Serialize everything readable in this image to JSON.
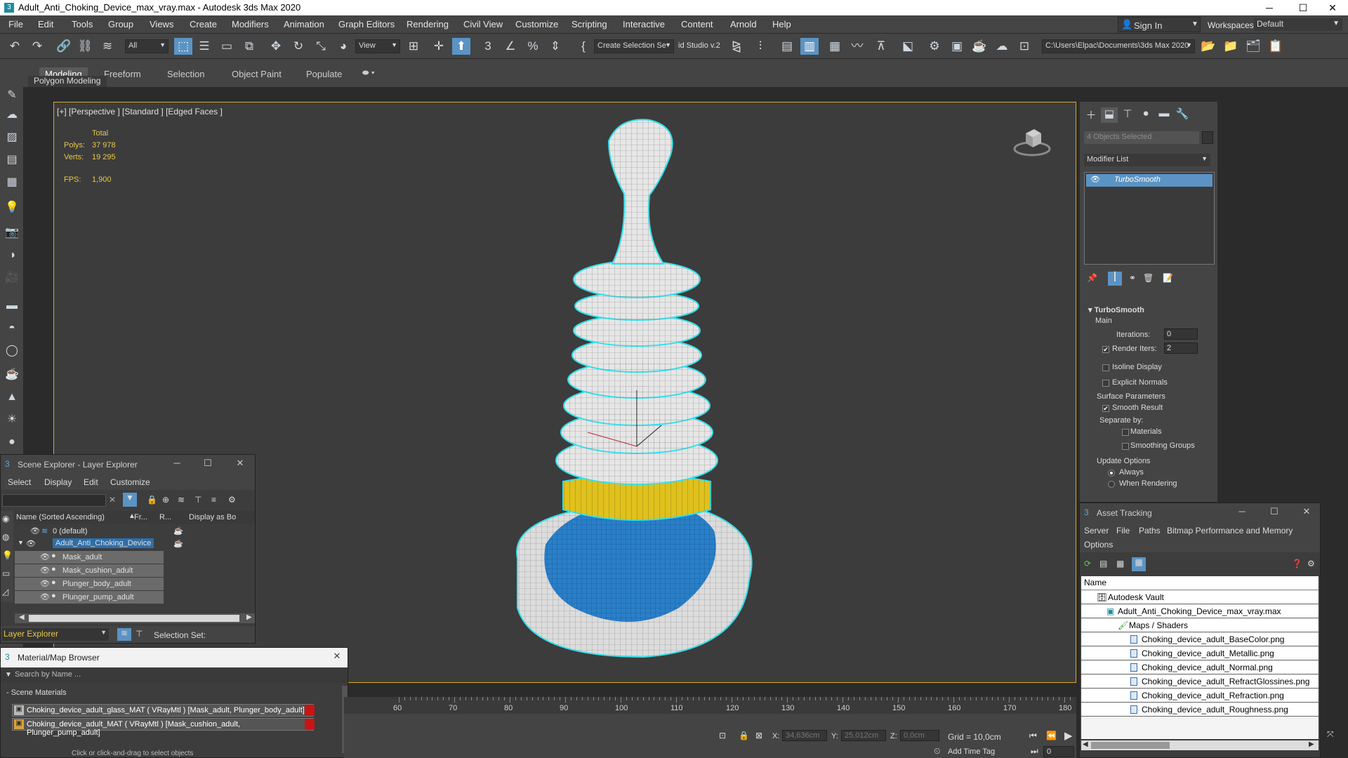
{
  "window": {
    "title": "Adult_Anti_Choking_Device_max_vray.max - Autodesk 3ds Max 2020",
    "app_icon": "3",
    "minimize_icon": "─",
    "maximize_icon": "☐",
    "close_icon": "✕"
  },
  "menu": [
    "File",
    "Edit",
    "Tools",
    "Group",
    "Views",
    "Create",
    "Modifiers",
    "Animation",
    "Graph Editors",
    "Rendering",
    "Civil View",
    "Customize",
    "Scripting",
    "Interactive",
    "Content",
    "Arnold",
    "Help"
  ],
  "account": {
    "sign_in": "Sign In",
    "workspaces_label": "Workspaces:",
    "workspace": "Default"
  },
  "toolbar": {
    "selection_filter": "All",
    "ref_coord": "View",
    "named_selection": "Create Selection Se",
    "studio": "id Studio v.2",
    "project_path": "C:\\Users\\Elpac\\Documents\\3ds Max 2020"
  },
  "ribbon": {
    "tabs": [
      "Modeling",
      "Freeform",
      "Selection",
      "Object Paint",
      "Populate"
    ],
    "active": "Modeling",
    "sub_label": "Polygon Modeling"
  },
  "viewport": {
    "label": "[+] [Perspective ] [Standard ] [Edged Faces ]",
    "stats": {
      "header": "Total",
      "polys_label": "Polys:",
      "polys": "37 978",
      "verts_label": "Verts:",
      "verts": "19 295",
      "fps_label": "FPS:",
      "fps": "1,900"
    }
  },
  "command_panel": {
    "selection": "4 Objects Selected",
    "modifier_list": "Modifier List",
    "stack_item": "TurboSmooth",
    "rollout_title": "TurboSmooth",
    "main_label": "Main",
    "iterations_label": "Iterations:",
    "iterations": "0",
    "render_iters_label": "Render Iters:",
    "render_iters": "2",
    "isoline": "Isoline Display",
    "explicit_normals": "Explicit Normals",
    "surface_params": "Surface Parameters",
    "smooth_result": "Smooth Result",
    "separate_by": "Separate by:",
    "materials": "Materials",
    "smoothing_groups": "Smoothing Groups",
    "update_options": "Update Options",
    "always": "Always",
    "when_rendering": "When Rendering"
  },
  "scene_explorer": {
    "title": "Scene Explorer - Layer Explorer",
    "menu": [
      "Select",
      "Display",
      "Edit",
      "Customize"
    ],
    "columns": [
      "Name (Sorted Ascending)",
      "Fr...",
      "R...",
      "Display as Bo"
    ],
    "rows": [
      {
        "name": "0 (default)",
        "level": 1
      },
      {
        "name": "Adult_Anti_Choking_Device",
        "level": 1
      },
      {
        "name": "Mask_adult",
        "level": 2
      },
      {
        "name": "Mask_cushion_adult",
        "level": 2
      },
      {
        "name": "Plunger_body_adult",
        "level": 2
      },
      {
        "name": "Plunger_pump_adult",
        "level": 2
      }
    ],
    "footer_combo": "Layer Explorer",
    "selection_set": "Selection Set:"
  },
  "material_browser": {
    "title": "Material/Map Browser",
    "search_placeholder": "Search by Name ...",
    "section": "- Scene Materials",
    "items": [
      "Choking_device_adult_glass_MAT ( VRayMtl ) [Mask_adult, Plunger_body_adult]",
      "Choking_device_adult_MAT ( VRayMtl ) [Mask_cushion_adult, Plunger_pump_adult]"
    ]
  },
  "asset_tracking": {
    "title": "Asset Tracking",
    "menu": [
      "Server",
      "File",
      "Paths",
      "Bitmap Performance and Memory",
      "Options"
    ],
    "column": "Name",
    "rows": [
      "Autodesk Vault",
      "Adult_Anti_Choking_Device_max_vray.max",
      "Maps / Shaders",
      "Choking_device_adult_BaseColor.png",
      "Choking_device_adult_Metallic.png",
      "Choking_device_adult_Normal.png",
      "Choking_device_adult_RefractGlossines.png",
      "Choking_device_adult_Refraction.png",
      "Choking_device_adult_Roughness.png"
    ]
  },
  "timeline": {
    "ticks": [
      "60",
      "70",
      "80",
      "90",
      "100",
      "110",
      "120",
      "130",
      "140",
      "150",
      "160",
      "170",
      "180"
    ]
  },
  "status": {
    "x_label": "X:",
    "x": "34,636cm",
    "y_label": "Y:",
    "y": "25,012cm",
    "z_label": "Z:",
    "z": "0,0cm",
    "grid": "Grid = 10,0cm",
    "add_time_tag": "Add Time Tag",
    "frame": "0",
    "prompt": "Click or click-and-drag to select objects"
  },
  "colors": {
    "accent": "#5b93c4",
    "viewport_border": "#d8a825",
    "selection_outline": "#2fe3ee",
    "mesh_blue": "#2a7fc7",
    "mesh_yellow": "#e0c11d",
    "material_red": "#c81414"
  }
}
